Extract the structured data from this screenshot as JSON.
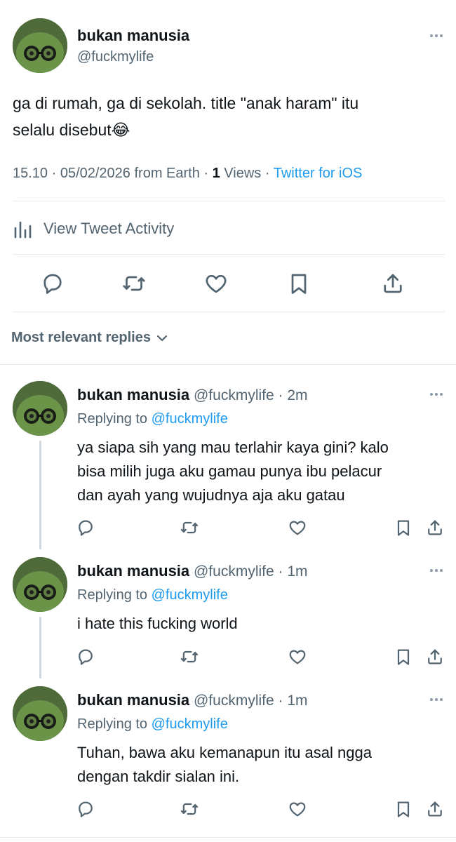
{
  "main_tweet": {
    "display_name": "bukan manusia",
    "handle": "@fuckmylife",
    "text_line1": "ga di rumah, ga di sekolah. title \"anak haram\" itu",
    "text_line2": "selalu disebut😂",
    "time_date": "15.10 · 05/02/2026 from Earth · ",
    "views_count": "1",
    "views_label": " Views · ",
    "source": "Twitter for iOS",
    "activity_label": "View Tweet Activity"
  },
  "replies_sort_label": "Most relevant replies",
  "replies": [
    {
      "display_name": "bukan manusia",
      "handle_time": " @fuckmylife · 2m",
      "replying_prefix": "Replying to ",
      "replying_handle": "@fuckmylife",
      "lines": [
        "ya siapa sih yang mau terlahir kaya gini? kalo",
        "bisa milih juga aku gamau punya ibu pelacur",
        "dan ayah yang wujudnya aja aku gatau"
      ]
    },
    {
      "display_name": "bukan manusia",
      "handle_time": " @fuckmylife · 1m",
      "replying_prefix": "Replying to ",
      "replying_handle": "@fuckmylife",
      "lines": [
        "i hate this fucking world"
      ]
    },
    {
      "display_name": "bukan manusia",
      "handle_time": " @fuckmylife · 1m",
      "replying_prefix": "Replying to ",
      "replying_handle": "@fuckmylife",
      "lines": [
        "Tuhan, bawa aku kemanapun itu asal ngga",
        "dengan takdir sialan ini."
      ]
    }
  ],
  "icons": {
    "reply": "reply-icon",
    "retweet": "retweet-icon",
    "like": "heart-icon",
    "bookmark": "bookmark-icon",
    "share": "share-icon",
    "more": "more-icon",
    "activity": "analytics-icon",
    "chevron": "chevron-down-icon"
  },
  "colors": {
    "text": "#0f1419",
    "secondary": "#536471",
    "link": "#1d9bf0",
    "divider": "#e6ecf0"
  }
}
